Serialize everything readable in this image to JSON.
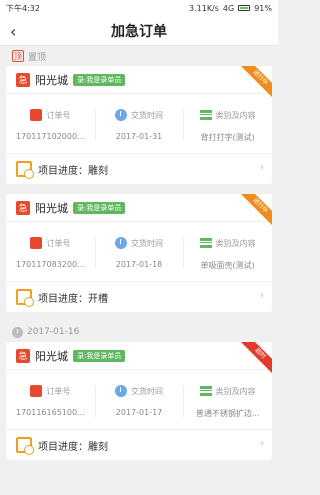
{
  "status": {
    "time": "下午4:32",
    "speed": "3.11K/s",
    "network": "4G",
    "battery": "91%"
  },
  "nav": {
    "title": "加急订单"
  },
  "sections": {
    "pinned_label": "置顶",
    "pinned_icon": "顶",
    "date_label": "2017-01-16"
  },
  "labels": {
    "order_no": "订单号",
    "delivery_time": "交货时间",
    "category": "类别及内容",
    "progress_prefix": "项目进度："
  },
  "cards": [
    {
      "shop": "阳光城",
      "shop_icon": "急",
      "badge": "录:我是录单员",
      "corner": "进行中",
      "order_no": "170117102000...",
      "delivery_time": "2017-01-31",
      "category": "背打打字(测试)",
      "progress": "雕刻"
    },
    {
      "shop": "阳光城",
      "shop_icon": "急",
      "badge": "录:我是录单员",
      "corner": "进行中",
      "order_no": "170117083200...",
      "delivery_time": "2017-01-18",
      "category": "单吸面壳(测试)",
      "progress": "开槽"
    },
    {
      "shop": "阳光城",
      "shop_icon": "急",
      "badge": "录:我是录单员",
      "corner": "超时",
      "order_no": "170116165100...",
      "delivery_time": "2017-01-17",
      "category": "普通不锈钢扩边...",
      "progress": "雕刻"
    }
  ],
  "colors": {
    "accent": "#e6492d",
    "badge": "#5fb85f",
    "corner_orange": "#f08c1e",
    "corner_red": "#e63a2e"
  }
}
